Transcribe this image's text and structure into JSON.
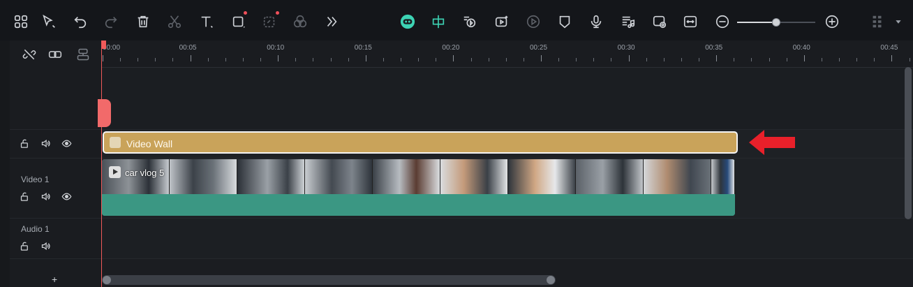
{
  "toolbar": {
    "icons": [
      "layout-grid-icon",
      "select-pointer-icon",
      "undo-icon",
      "redo-icon",
      "delete-icon",
      "cut-icon",
      "text-icon",
      "crop-icon",
      "ai-mask-icon",
      "color-icon",
      "more-icon"
    ],
    "right_icons": [
      "ai-copilot-icon",
      "split-icon",
      "ai-audio-icon",
      "ai-video-icon",
      "render-preview-icon",
      "marker-icon",
      "microphone-icon",
      "audio-list-icon",
      "snapshot-icon",
      "fit-icon",
      "zoom-out-icon",
      "zoom-in-icon",
      "panel-layout-icon",
      "dropdown-icon"
    ],
    "zoom_level": 0.5
  },
  "panel_tools": [
    "unlink-icon",
    "link-icon",
    "group-icon"
  ],
  "ruler": {
    "labels": [
      "00:00",
      "00:05",
      "00:10",
      "00:15",
      "00:20",
      "00:25",
      "00:30",
      "00:35",
      "00:40",
      "00:45"
    ]
  },
  "tracks": {
    "effect_track": {
      "name": ""
    },
    "video1": {
      "name": "Video 1"
    },
    "audio1": {
      "name": "Audio 1"
    }
  },
  "clips": {
    "effect": {
      "label": "Video Wall",
      "color": "#c9a35a"
    },
    "video": {
      "label": "car vlog 5",
      "color": "#3b9783"
    }
  },
  "add_track_label": "+",
  "accent": {
    "playhead": "#f05a5a",
    "teal": "#3dd3b4",
    "arrow": "#e8202a"
  }
}
